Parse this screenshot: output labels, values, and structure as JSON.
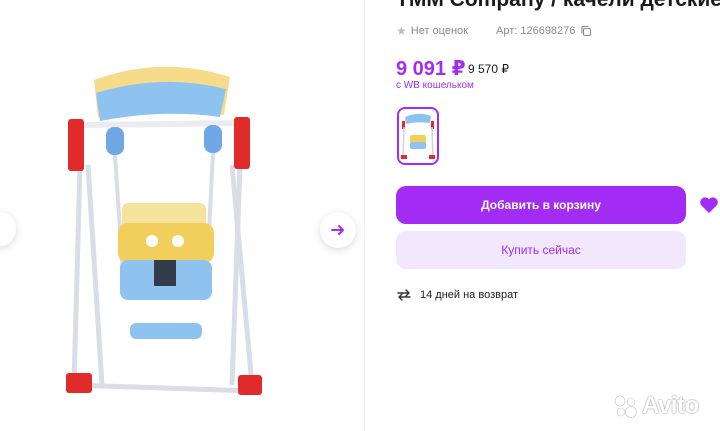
{
  "product": {
    "title": "ТММ Company / качели детские ...",
    "rating_text": "Нет оценок",
    "article_label": "Арт: 126698276",
    "price": "9 091 ₽",
    "old_price": "9 570 ₽",
    "wallet_note": "с WB кошельком"
  },
  "actions": {
    "add_to_cart": "Добавить в корзину",
    "buy_now": "Купить сейчас"
  },
  "returns": {
    "text": "14 дней на возврат"
  },
  "watermark": {
    "text": "Avito"
  },
  "colors": {
    "accent": "#a22cf3",
    "accent_light": "#f2e8fd",
    "muted": "#8b8b93"
  },
  "icons": [
    "chevron-left-icon",
    "arrow-right-icon",
    "star-icon",
    "copy-icon",
    "heart-icon",
    "return-arrows-icon",
    "avito-logo"
  ]
}
